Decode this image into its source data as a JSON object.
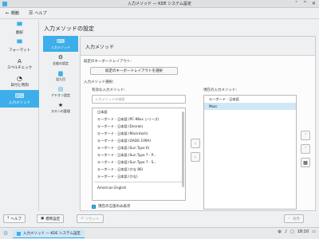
{
  "window": {
    "title": "入力メソッド — KDE システム設定",
    "controls": [
      "˅",
      "^",
      "✕"
    ]
  },
  "toolbar": {
    "back_label": "概観",
    "help_label": "ヘルプ"
  },
  "sidebar": {
    "items": [
      {
        "label": "翻訳",
        "icon": "speech-bubble-icon"
      },
      {
        "label": "フォーマット",
        "icon": "speech-bubble-icon"
      },
      {
        "label": "スペルチェック",
        "icon": "spellcheck-icon"
      },
      {
        "label": "日付と時刻",
        "icon": "clock-icon"
      },
      {
        "label": "入力メソッド",
        "icon": "keyboard-icon"
      }
    ]
  },
  "page_title": "入力メソッドの設定",
  "subnav": {
    "items": [
      {
        "label": "入力メソッド",
        "icon": "keyboard-icon"
      },
      {
        "label": "全般の設定",
        "icon": "gear-icon"
      },
      {
        "label": "見た目",
        "icon": "appearance-icon"
      },
      {
        "label": "アドオン設定",
        "icon": "addon-icon"
      },
      {
        "label": "スキンの管理",
        "icon": "star-icon"
      }
    ]
  },
  "panel": {
    "heading": "入力メソッド",
    "default_layout_label": "既定のキーボードレイアウト:",
    "default_layout_button": "既定のキーボードレイアウトを選択",
    "select_label": "入力メソッド選択:",
    "available_label": "有効な入力メソッド:",
    "current_label": "現在の入力メソッド:",
    "search_placeholder": "入力メソッドの検索",
    "available_group": "日本語",
    "available_items": [
      "キーボード - 日本語 (PC-98xx シリーズ)",
      "キーボード - 日本語 (Dvorak)",
      "キーボード - 日本語 (Macintosh)",
      "キーボード - 日本語 (OADG 109A)",
      "キーボード - 日本語 (Sun Type 6)",
      "キーボード - 日本語 (Sun Type 7 - P...",
      "キーボード - 日本語 (Sun Type 7 - S...",
      "キーボード - 日本語 (かな 86)",
      "キーボード - 日本語 (かな)"
    ],
    "available_group2": "American English",
    "current_items": [
      "キーボード - 日本語",
      "Mozc"
    ],
    "current_selected_index": 1,
    "only_current_language": "現在の言語のみ表示",
    "arrows": {
      "left": "‹",
      "right": "›",
      "up": "˄",
      "down": "˅",
      "config": "▦"
    }
  },
  "bottom": {
    "help": "ヘルプ",
    "defaults": "標準設定",
    "reset": "リセット",
    "apply": "適用"
  },
  "taskbar": {
    "task_label": "入力メソッド — KDE システム設定",
    "clock": "18:10"
  }
}
